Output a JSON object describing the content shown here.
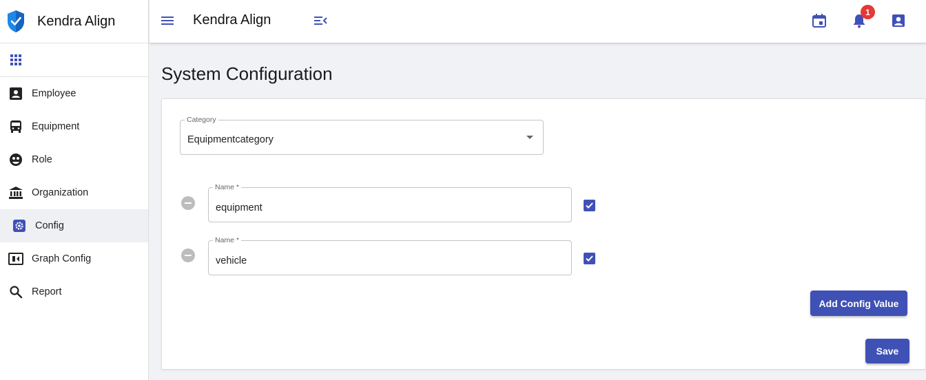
{
  "app": {
    "name": "Kendra Align"
  },
  "colors": {
    "accent": "#3f51b5",
    "badge": "#e53935",
    "logo": "#1e88e5"
  },
  "sidebar": {
    "items": [
      {
        "label": "Employee",
        "icon": "account-box-icon"
      },
      {
        "label": "Equipment",
        "icon": "bus-icon"
      },
      {
        "label": "Role",
        "icon": "face-icon"
      },
      {
        "label": "Organization",
        "icon": "bank-icon"
      },
      {
        "label": "Config",
        "icon": "settings-icon",
        "active": true
      },
      {
        "label": "Graph Config",
        "icon": "graph-config-icon"
      },
      {
        "label": "Report",
        "icon": "search-icon"
      }
    ]
  },
  "topbar": {
    "title": "Kendra Align",
    "notification_count": "1"
  },
  "page": {
    "title": "System Configuration"
  },
  "form": {
    "category": {
      "label": "Category",
      "value": "Equipmentcategory"
    },
    "rows": [
      {
        "label": "Name *",
        "value": "equipment",
        "checked": true
      },
      {
        "label": "Name *",
        "value": "vehicle",
        "checked": true
      }
    ],
    "add_button": "Add Config Value",
    "save_button": "Save"
  }
}
